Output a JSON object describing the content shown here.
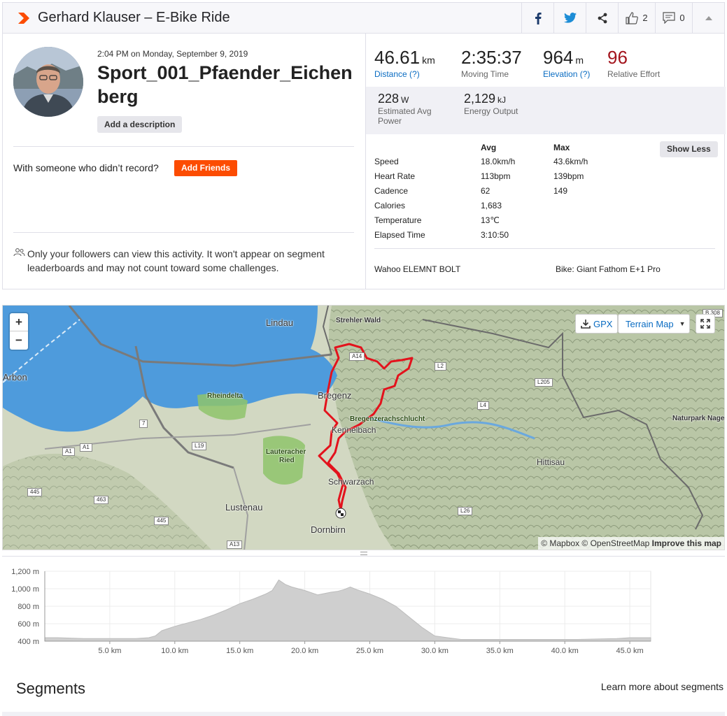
{
  "header": {
    "title": "Gerhard Klauser – E-Bike Ride",
    "kudos_count": "2",
    "comments_count": "0"
  },
  "activity": {
    "date": "2:04 PM on Monday, September 9, 2019",
    "name": "Sport_001_Pfaender_Eichenberg",
    "add_description": "Add a description",
    "with_someone": "With someone who didn’t record?",
    "add_friends": "Add Friends",
    "privacy_notice": "Only your followers can view this activity. It won't appear on segment leaderboards and may not count toward some challenges."
  },
  "stats": {
    "distance": {
      "value": "46.61",
      "unit": "km",
      "label": "Distance (?)"
    },
    "moving_time": {
      "value": "2:35:37",
      "label": "Moving Time"
    },
    "elevation": {
      "value": "964",
      "unit": "m",
      "label": "Elevation (?)"
    },
    "relative_effort": {
      "value": "96",
      "label": "Relative Effort"
    },
    "power": {
      "value": "228",
      "unit": "W",
      "label": "Estimated Avg Power"
    },
    "energy": {
      "value": "2,129",
      "unit": "kJ",
      "label": "Energy Output"
    }
  },
  "details": {
    "headers": [
      "Avg",
      "Max"
    ],
    "show_less": "Show Less",
    "rows": [
      {
        "label": "Speed",
        "avg": "18.0km/h",
        "max": "43.6km/h"
      },
      {
        "label": "Heart Rate",
        "avg": "113bpm",
        "max": "139bpm"
      },
      {
        "label": "Cadence",
        "avg": "62",
        "max": "149"
      },
      {
        "label": "Calories",
        "avg": "1,683",
        "max": ""
      },
      {
        "label": "Temperature",
        "avg": "13℃",
        "max": ""
      },
      {
        "label": "Elapsed Time",
        "avg": "3:10:50",
        "max": ""
      }
    ],
    "device": "Wahoo ELEMNT BOLT",
    "bike": "Bike: Giant Fathom E+1 Pro"
  },
  "map": {
    "zoom_in": "+",
    "zoom_out": "−",
    "gpx_label": "GPX",
    "map_type": "Terrain Map",
    "attribution": "© Mapbox © OpenStreetMap",
    "improve": "Improve this map",
    "places": {
      "lindau": "Lindau",
      "strehler_wald": "Strehler Wald",
      "arbon": "Arbon",
      "rheindelta": "Rheindelta",
      "bregenz": "Bregenz",
      "bregenzerachschlucht": "Bregenzerachschlucht",
      "kennelbach": "Kennelbach",
      "lauteracher_ried_1": "Lauteracher",
      "lauteracher_ried_2": "Ried",
      "schwarzach": "Schwarzach",
      "lustenau": "Lustenau",
      "dornbirn": "Dornbirn",
      "hittisau": "Hittisau",
      "naturpark": "Naturpark Nage"
    },
    "roads": {
      "a14": "A14",
      "l2": "L2",
      "l205": "L205",
      "l4": "L4",
      "seven": "7",
      "a1a": "A1",
      "a1b": "A1",
      "l19": "L19",
      "r445a": "445",
      "r463": "463",
      "r445b": "445",
      "a13": "A13",
      "l26": "L26",
      "b308": "B 308"
    },
    "route_color": "#e3121c"
  },
  "chart_data": {
    "type": "area",
    "title": "",
    "xlabel": "",
    "ylabel": "",
    "x_unit": "km",
    "y_unit": "m",
    "xlim": [
      0,
      46.61
    ],
    "ylim": [
      400,
      1200
    ],
    "x_ticks": [
      "5.0 km",
      "10.0 km",
      "15.0 km",
      "20.0 km",
      "25.0 km",
      "30.0 km",
      "35.0 km",
      "40.0 km",
      "45.0 km"
    ],
    "y_ticks": [
      "400 m",
      "600 m",
      "800 m",
      "1,000 m",
      "1,200 m"
    ],
    "x_tick_values": [
      5,
      10,
      15,
      20,
      25,
      30,
      35,
      40,
      45
    ],
    "y_tick_values": [
      400,
      600,
      800,
      1000,
      1200
    ],
    "x": [
      0,
      1,
      3,
      5,
      7,
      8,
      8.5,
      9,
      10,
      11,
      12,
      13,
      14,
      15,
      16,
      17,
      17.5,
      18,
      18.5,
      19,
      20,
      21,
      22,
      22.5,
      23,
      23.5,
      24,
      25,
      26,
      27,
      28,
      29,
      30,
      32,
      35,
      38,
      41,
      44,
      45,
      46,
      46.61
    ],
    "y": [
      440,
      440,
      430,
      430,
      430,
      440,
      460,
      520,
      570,
      610,
      650,
      700,
      760,
      830,
      880,
      940,
      980,
      1100,
      1050,
      1020,
      980,
      930,
      960,
      970,
      990,
      1020,
      990,
      940,
      880,
      800,
      680,
      560,
      460,
      420,
      420,
      420,
      420,
      430,
      440,
      440,
      440
    ],
    "fill_color": "#cfcfcf",
    "grid": true
  },
  "segments": {
    "title": "Segments",
    "learn_more": "Learn more about segments"
  }
}
